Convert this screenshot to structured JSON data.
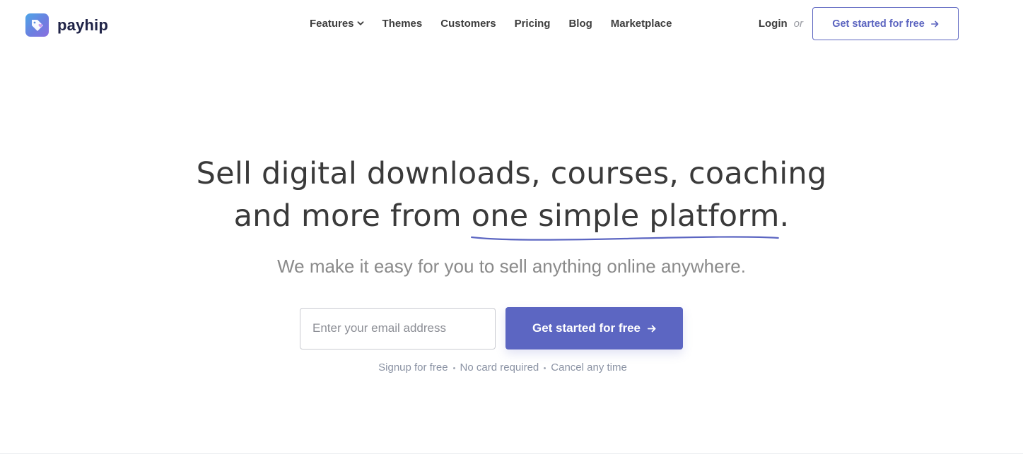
{
  "brand": {
    "name": "payhip",
    "accent_color": "#5c66c2",
    "logo_icon": "heart-tag-icon"
  },
  "nav": {
    "items": [
      {
        "label": "Features",
        "has_dropdown": true
      },
      {
        "label": "Themes"
      },
      {
        "label": "Customers"
      },
      {
        "label": "Pricing"
      },
      {
        "label": "Blog"
      },
      {
        "label": "Marketplace"
      }
    ]
  },
  "auth": {
    "login_label": "Login",
    "or_label": "or",
    "cta_label": "Get started for free"
  },
  "hero": {
    "headline_line1": "Sell digital downloads, courses, coaching",
    "headline_line2_prefix": "and more from ",
    "headline_highlight": "one simple platform",
    "headline_line2_suffix": ".",
    "subheadline": "We make it easy for you to sell anything online anywhere.",
    "email_placeholder": "Enter your email address",
    "email_value": "",
    "cta_label": "Get started for free",
    "benefits": [
      "Signup for free",
      "No card required",
      "Cancel any time"
    ]
  }
}
